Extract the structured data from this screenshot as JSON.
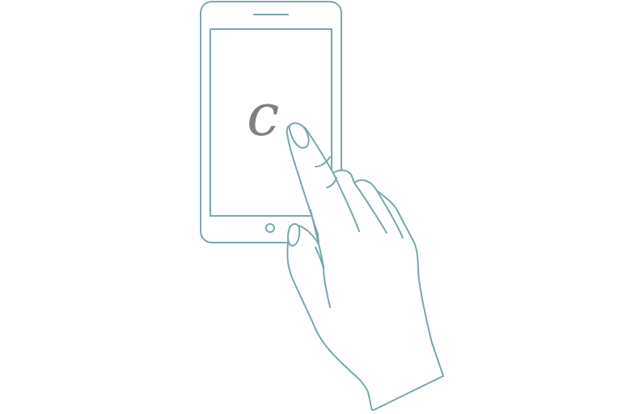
{
  "illustration": {
    "drawn_letter": "c",
    "colors": {
      "outline": "#7aa6ad",
      "letter": "#808080",
      "background": "#ffffff"
    },
    "icons": [
      "smartphone-icon",
      "hand-icon"
    ]
  }
}
